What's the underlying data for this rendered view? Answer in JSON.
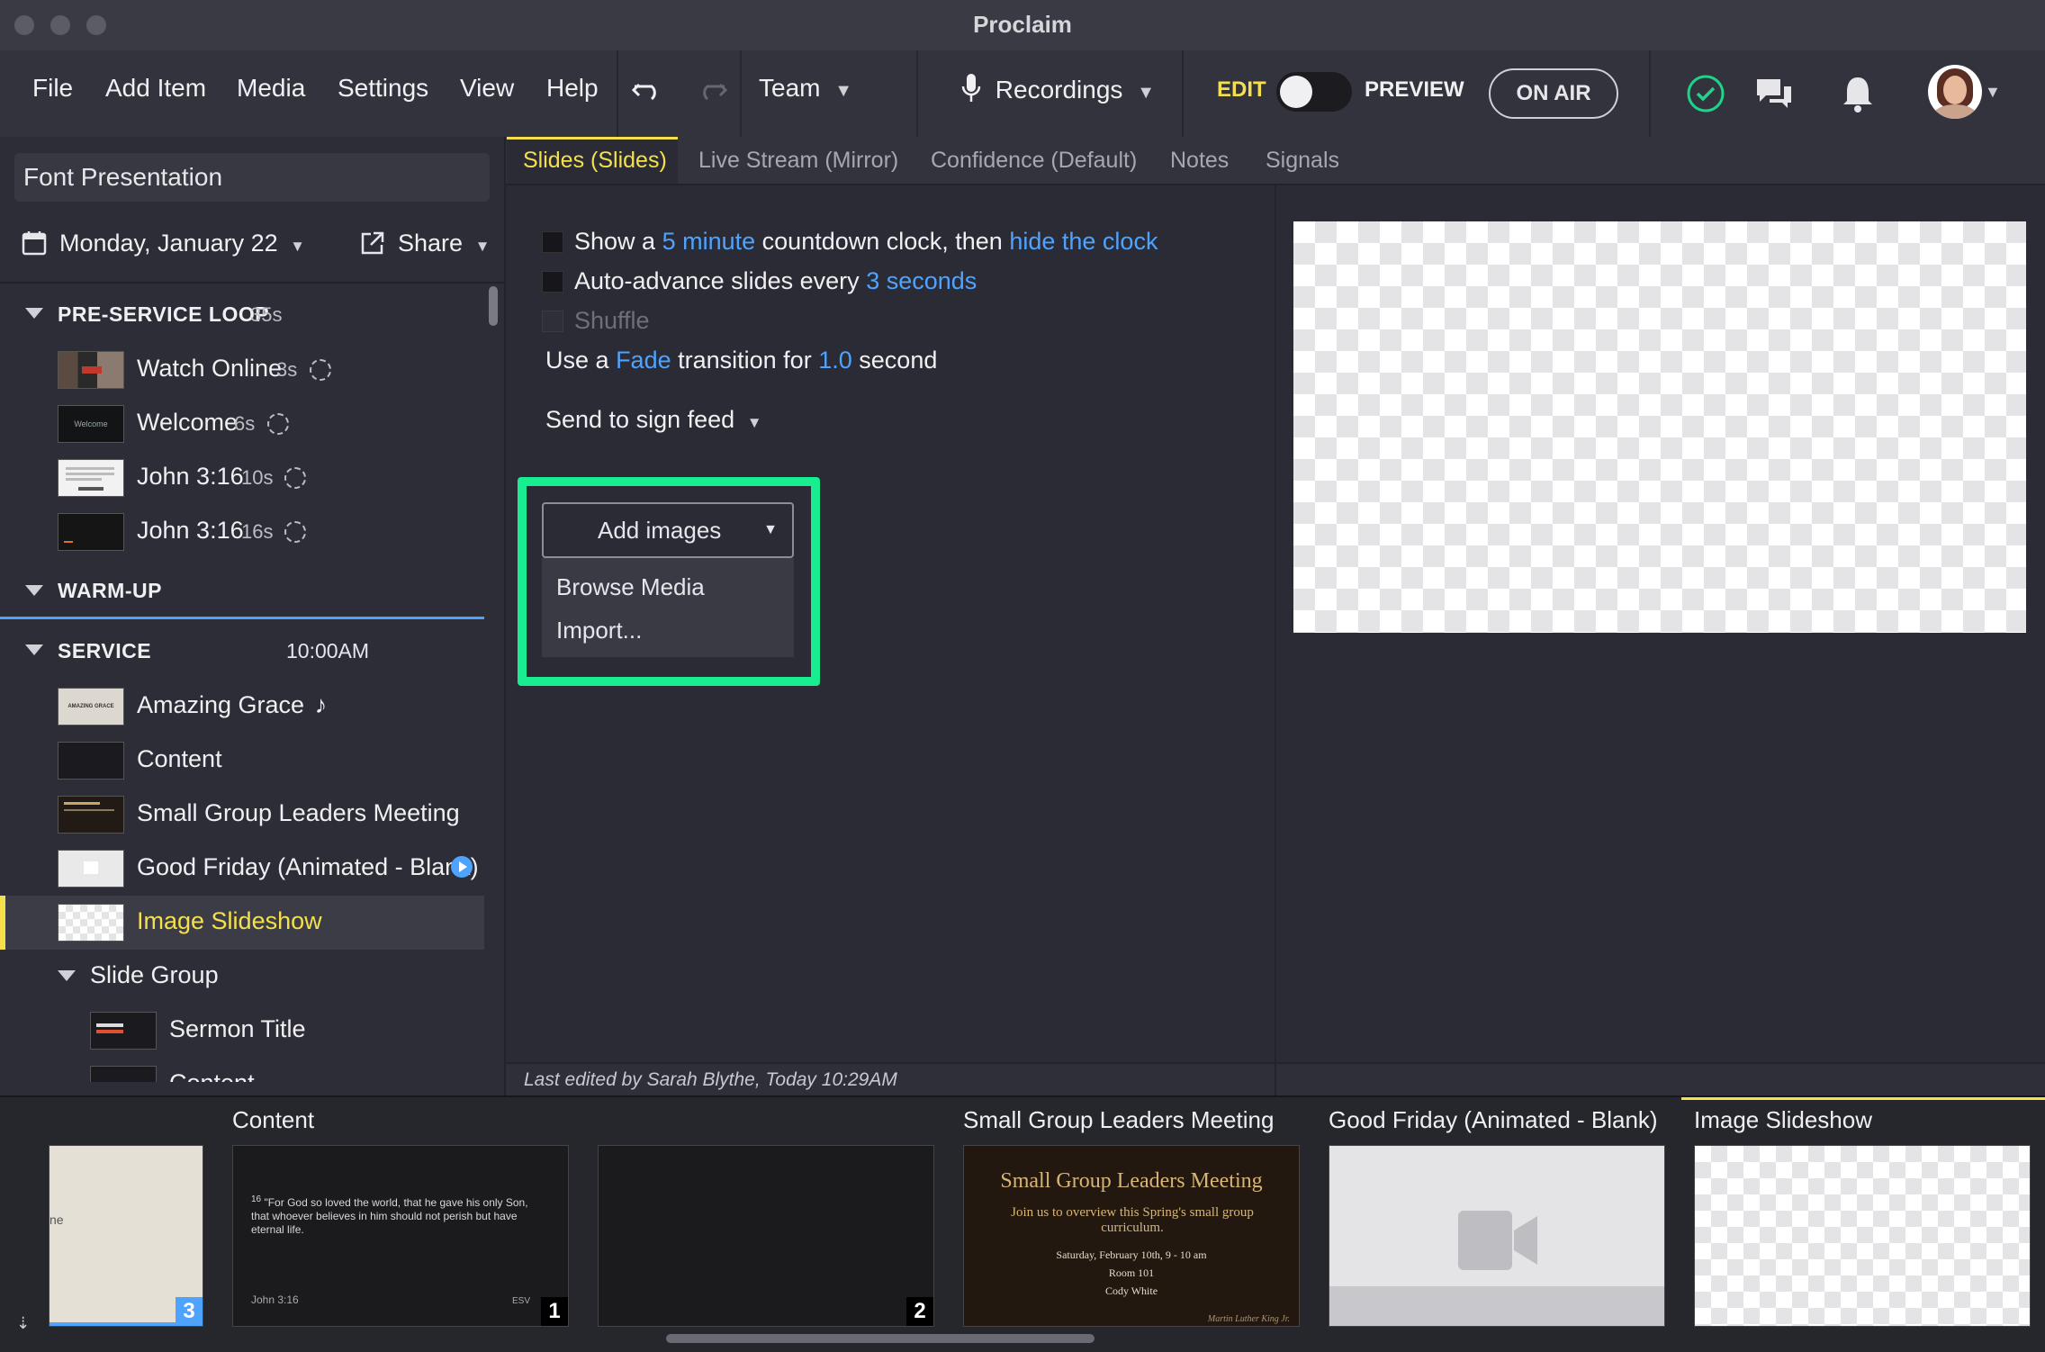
{
  "app": {
    "title": "Proclaim"
  },
  "menu": {
    "items": [
      "File",
      "Add Item",
      "Media",
      "Settings",
      "View",
      "Help"
    ],
    "team": "Team",
    "recordings": "Recordings",
    "edit": "EDIT",
    "preview": "PREVIEW",
    "on_air": "ON AIR"
  },
  "sidebar": {
    "presentation_title": "Font Presentation",
    "date": "Monday, January 22",
    "share": "Share",
    "sections": [
      {
        "title": "PRE-SERVICE LOOP",
        "duration": "35s",
        "items": [
          {
            "label": "Watch Online",
            "duration": "3s"
          },
          {
            "label": "Welcome",
            "duration": "6s"
          },
          {
            "label": "John 3:16",
            "duration": "10s"
          },
          {
            "label": "John 3:16",
            "duration": "16s"
          }
        ]
      },
      {
        "title": "WARM-UP"
      },
      {
        "title": "SERVICE",
        "time": "10:00AM",
        "items": [
          {
            "label": "Amazing Grace",
            "suffix": "♪"
          },
          {
            "label": "Content"
          },
          {
            "label": "Small Group Leaders Meeting"
          },
          {
            "label": "Good Friday (Animated - Blank)"
          },
          {
            "label": "Image Slideshow"
          }
        ]
      }
    ],
    "group": {
      "title": "Slide Group",
      "items": [
        "Sermon Title",
        "Content"
      ]
    }
  },
  "tabs": [
    "Slides (Slides)",
    "Live Stream (Mirror)",
    "Confidence (Default)",
    "Notes",
    "Signals"
  ],
  "settings": {
    "countdown": {
      "prefix": "Show a",
      "minutes": "5 minute",
      "middle": "countdown clock, then",
      "action": "hide the clock"
    },
    "autoadvance": {
      "prefix": "Auto-advance slides every",
      "interval": "3 seconds"
    },
    "shuffle": "Shuffle",
    "transition": {
      "prefix": "Use a",
      "type": "Fade",
      "middle": "transition for",
      "duration": "1.0",
      "suffix": "second"
    },
    "sign_feed": "Send to sign feed"
  },
  "add_images": {
    "label": "Add images",
    "options": [
      "Browse Media",
      "Import..."
    ]
  },
  "status": {
    "last_edited": "Last edited by Sarah Blythe, Today 10:29AM"
  },
  "strip": {
    "labels": {
      "content": "Content",
      "sglm": "Small Group Leaders Meeting",
      "gf": "Good Friday (Animated - Blank)",
      "is": "Image Slideshow"
    },
    "slide0": {
      "fragment": "ne",
      "badge": "3"
    },
    "slide1": {
      "verse_num": "16",
      "text": "\"For God so loved the world, that he gave his only Son, that whoever believes in him should not perish but have eternal life.",
      "ref": "John 3:16",
      "version": "ESV",
      "badge": "1"
    },
    "slide2": {
      "badge": "2"
    },
    "slide3": {
      "title": "Small Group Leaders Meeting",
      "body": "Join us to overview this Spring's small group curriculum.",
      "date": "Saturday, February 10th, 9 - 10 am",
      "room": "Room 101",
      "person": "Cody White",
      "signature": "Martin Luther King Jr."
    }
  },
  "colors": {
    "accent_yellow": "#f4e04d",
    "link_blue": "#4ea3ff",
    "highlight_green": "#18ee8f",
    "status_green": "#1ed48a"
  }
}
